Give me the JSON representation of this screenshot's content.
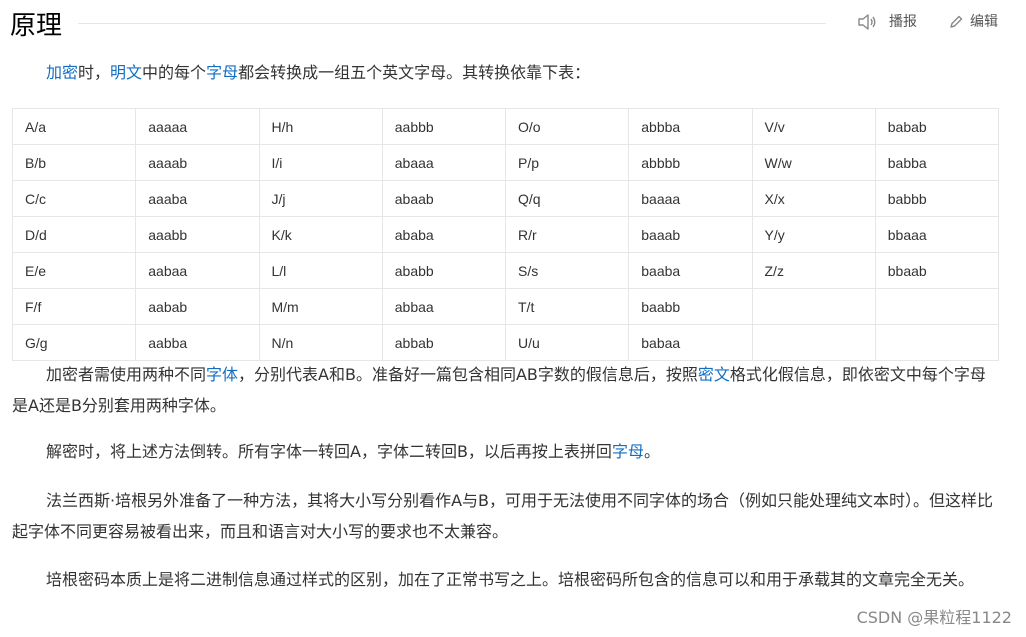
{
  "header": {
    "title": "原理",
    "play_label": "播报",
    "edit_label": "编辑",
    "play_icon": "speaker-icon",
    "edit_icon": "pencil-icon"
  },
  "intro": {
    "link1": "加密",
    "t1": "时，",
    "link2": "明文",
    "t2": "中的每个",
    "link3": "字母",
    "t3": "都会转换成一组五个英文字母。其转换依靠下表："
  },
  "table": {
    "rows": [
      [
        "A/a",
        "aaaaa",
        "H/h",
        "aabbb",
        "O/o",
        "abbba",
        "V/v",
        "babab"
      ],
      [
        "B/b",
        "aaaab",
        "I/i",
        "abaaa",
        "P/p",
        "abbbb",
        "W/w",
        "babba"
      ],
      [
        "C/c",
        "aaaba",
        "J/j",
        "abaab",
        "Q/q",
        "baaaa",
        "X/x",
        "babbb"
      ],
      [
        "D/d",
        "aaabb",
        "K/k",
        "ababa",
        "R/r",
        "baaab",
        "Y/y",
        "bbaaa"
      ],
      [
        "E/e",
        "aabaa",
        "L/l",
        "ababb",
        "S/s",
        "baaba",
        "Z/z",
        "bbaab"
      ],
      [
        "F/f",
        "aabab",
        "M/m",
        "abbaa",
        "T/t",
        "baabb",
        "",
        ""
      ],
      [
        "G/g",
        "aabba",
        "N/n",
        "abbab",
        "U/u",
        "babaa",
        "",
        ""
      ]
    ]
  },
  "p2": {
    "t1": "加密者需使用两种不同",
    "link1": "字体",
    "t2": "，分别代表A和B。准备好一篇包含相同AB字数的假信息后，按照",
    "link2": "密文",
    "t3": "格式化假信息，即依密文中每个字母是A还是B分别套用两种字体。"
  },
  "p3": {
    "t1": "解密时，将上述方法倒转。所有字体一转回A，字体二转回B，以后再按上表拼回",
    "link1": "字母",
    "t2": "。"
  },
  "p4": {
    "text": "法兰西斯·培根另外准备了一种方法，其将大小写分别看作A与B，可用于无法使用不同字体的场合（例如只能处理纯文本时）。但这样比起字体不同更容易被看出来，而且和语言对大小写的要求也不太兼容。"
  },
  "p5": {
    "text": "培根密码本质上是将二进制信息通过样式的区别，加在了正常书写之上。培根密码所包含的信息可以和用于承载其的文章完全无关。"
  },
  "watermark": "CSDN @果粒程1122",
  "colors": {
    "link": "#136ec2",
    "text": "#333333",
    "border": "#e6e6e6"
  }
}
